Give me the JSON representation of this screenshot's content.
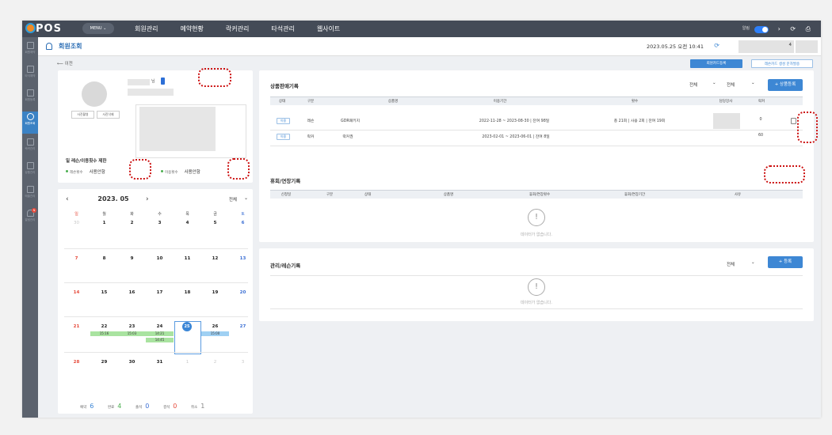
{
  "app": {
    "logo": "POS",
    "menu_label": "MENU ⌄",
    "top_nav": [
      "회원관리",
      "예약현황",
      "락커관리",
      "타석관리",
      "웹사이트"
    ],
    "alarm_label": "알림",
    "top_icons": "‹ › ⟳ ⎙"
  },
  "sidebar": [
    {
      "label": "회원예약",
      "icon": "calendar-icon"
    },
    {
      "label": "타석예약",
      "icon": "grid-icon"
    },
    {
      "label": "회원등록",
      "icon": "user-plus-icon"
    },
    {
      "label": "회원조회",
      "icon": "user-icon",
      "active": true
    },
    {
      "label": "락커관리",
      "icon": "locker-icon"
    },
    {
      "label": "상품관리",
      "icon": "box-icon"
    },
    {
      "label": "매출관리",
      "icon": "chart-icon"
    },
    {
      "label": "알림관리",
      "icon": "bell-icon",
      "badge": "N"
    }
  ],
  "header": {
    "title": "회원조회",
    "datetime": "2023.05.25 오전 10:41",
    "member_card_btn": "회원카드등록",
    "lesson_card_btn": "레슨카드 생성 문자발송",
    "back": "이전",
    "grey_suffix": "4"
  },
  "profile": {
    "name_suffix": "님",
    "photo_btn": "사진촬영",
    "photo_del_btn": "사진삭제",
    "limit_title": "일 레슨/이용횟수 제한",
    "lesson_label": "레슨횟수",
    "lesson_value": "사용안함",
    "use_label": "이용횟수",
    "use_value": "사용안함"
  },
  "calendar": {
    "month": "2023. 05",
    "prev": "‹",
    "next": "›",
    "filter": "전체",
    "chevron": "⌄",
    "weekdays": [
      "일",
      "월",
      "화",
      "수",
      "목",
      "금",
      "토"
    ],
    "weeks": [
      [
        "30",
        "1",
        "2",
        "3",
        "4",
        "5",
        "6"
      ],
      [
        "7",
        "8",
        "9",
        "10",
        "11",
        "12",
        "13"
      ],
      [
        "14",
        "15",
        "16",
        "17",
        "18",
        "19",
        "20"
      ],
      [
        "21",
        "22",
        "23",
        "24",
        "25",
        "26",
        "27"
      ],
      [
        "28",
        "29",
        "30",
        "31",
        "1",
        "2",
        "3"
      ]
    ],
    "events": [
      {
        "day": "22",
        "time": "15:16",
        "color": "g"
      },
      {
        "day": "23",
        "time": "15:03",
        "color": "g"
      },
      {
        "day": "24",
        "time": "14:21",
        "color": "g"
      },
      {
        "day": "24",
        "time": "14:45",
        "color": "g"
      },
      {
        "day": "26",
        "time": "15:00",
        "color": "b"
      }
    ],
    "summary": [
      {
        "label": "예약",
        "value": "6"
      },
      {
        "label": "완료",
        "value": "4"
      },
      {
        "label": "출석",
        "value": "0"
      },
      {
        "label": "결석",
        "value": "0"
      },
      {
        "label": "취소",
        "value": "1"
      }
    ]
  },
  "sales": {
    "title": "상품판매기록",
    "filter1": "전체",
    "filter2": "전체",
    "add_btn": "+ 상품등록",
    "headers": [
      "상태",
      "구분",
      "상품명",
      "이용기간",
      "횟수",
      "담당강사",
      "락커"
    ],
    "rows": [
      {
        "status": "이용",
        "type": "레슨",
        "name": "GDR패키지",
        "period": "2022-11-28 ~ 2023-08-30",
        "remain_label": "잔여",
        "remain": "98일",
        "count_total": "총 21회",
        "count_used": "사용 2회",
        "count_remain_label": "잔여",
        "count_remain": "19회",
        "locker": "0"
      },
      {
        "status": "이용",
        "type": "락커",
        "name": "락커권",
        "period": "2023-02-01 ~ 2023-06-01",
        "remain_label": "잔여",
        "remain": "8일",
        "count_total": "",
        "count_used": "",
        "count_remain_label": "",
        "count_remain": "",
        "locker": "60"
      }
    ]
  },
  "leave": {
    "title": "휴회/연장기록",
    "headers": [
      "신청일",
      "구분",
      "상태",
      "상품명",
      "휴회/연장횟수",
      "휴회/연장기간",
      "사유"
    ],
    "empty": "데이터가 없습니다."
  },
  "mgmt": {
    "title": "관리/레슨기록",
    "filter": "전체",
    "add_btn": "+ 등록",
    "empty": "데이터가 없습니다."
  }
}
